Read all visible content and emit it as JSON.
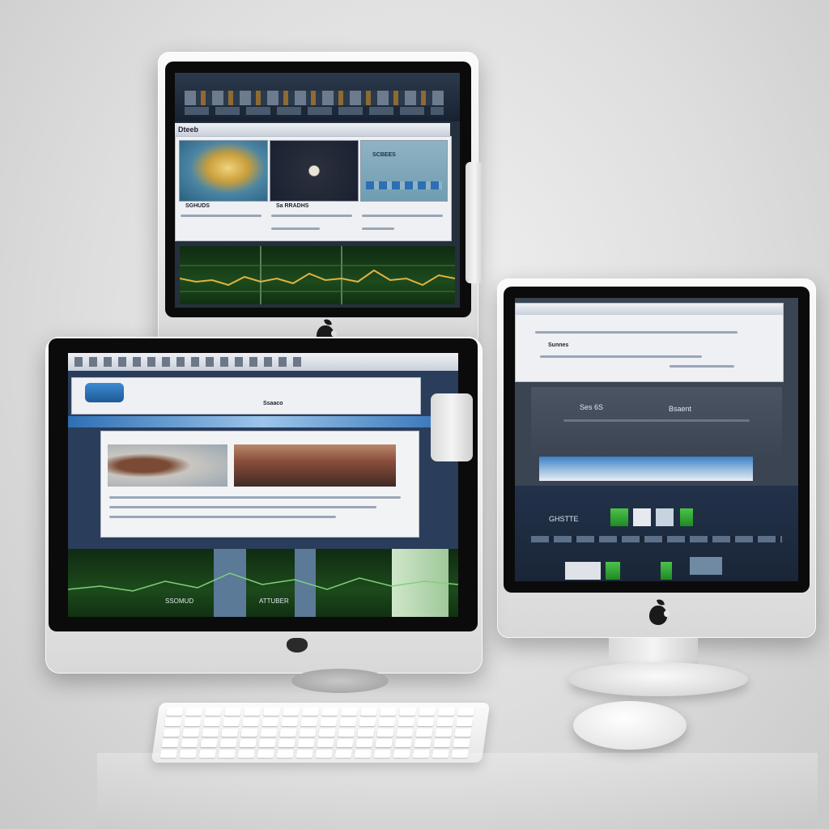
{
  "scene": {
    "objects": [
      "top-monitor",
      "left-monitor",
      "right-monitor",
      "keyboard",
      "mouse"
    ],
    "brand_logo_icon": "apple-logo-icon",
    "colors": {
      "backdrop": "#dcdcdc",
      "screen_dark": "#1c2430",
      "chart_green": "#2f8f2f",
      "chart_line": "#e0b341",
      "accent_blue": "#2d6fb5"
    }
  },
  "top_monitor": {
    "window_title": "Dteeb",
    "tile_captions": [
      "SGHUDS",
      "Sa RRADHS",
      ""
    ],
    "tile3_header": "SCBEES",
    "chart_line_color": "#e0b341"
  },
  "left_monitor": {
    "toolbar_label": "Ssaaco",
    "bottom_labels": [
      "SSOMUD",
      "ATTUBER"
    ]
  },
  "right_monitor": {
    "top_panel_text": "Sunnes",
    "mid_text_1": "Ses 6S",
    "mid_text_2": "Bsaent",
    "bottom_panel_label": "GHSTTE"
  }
}
